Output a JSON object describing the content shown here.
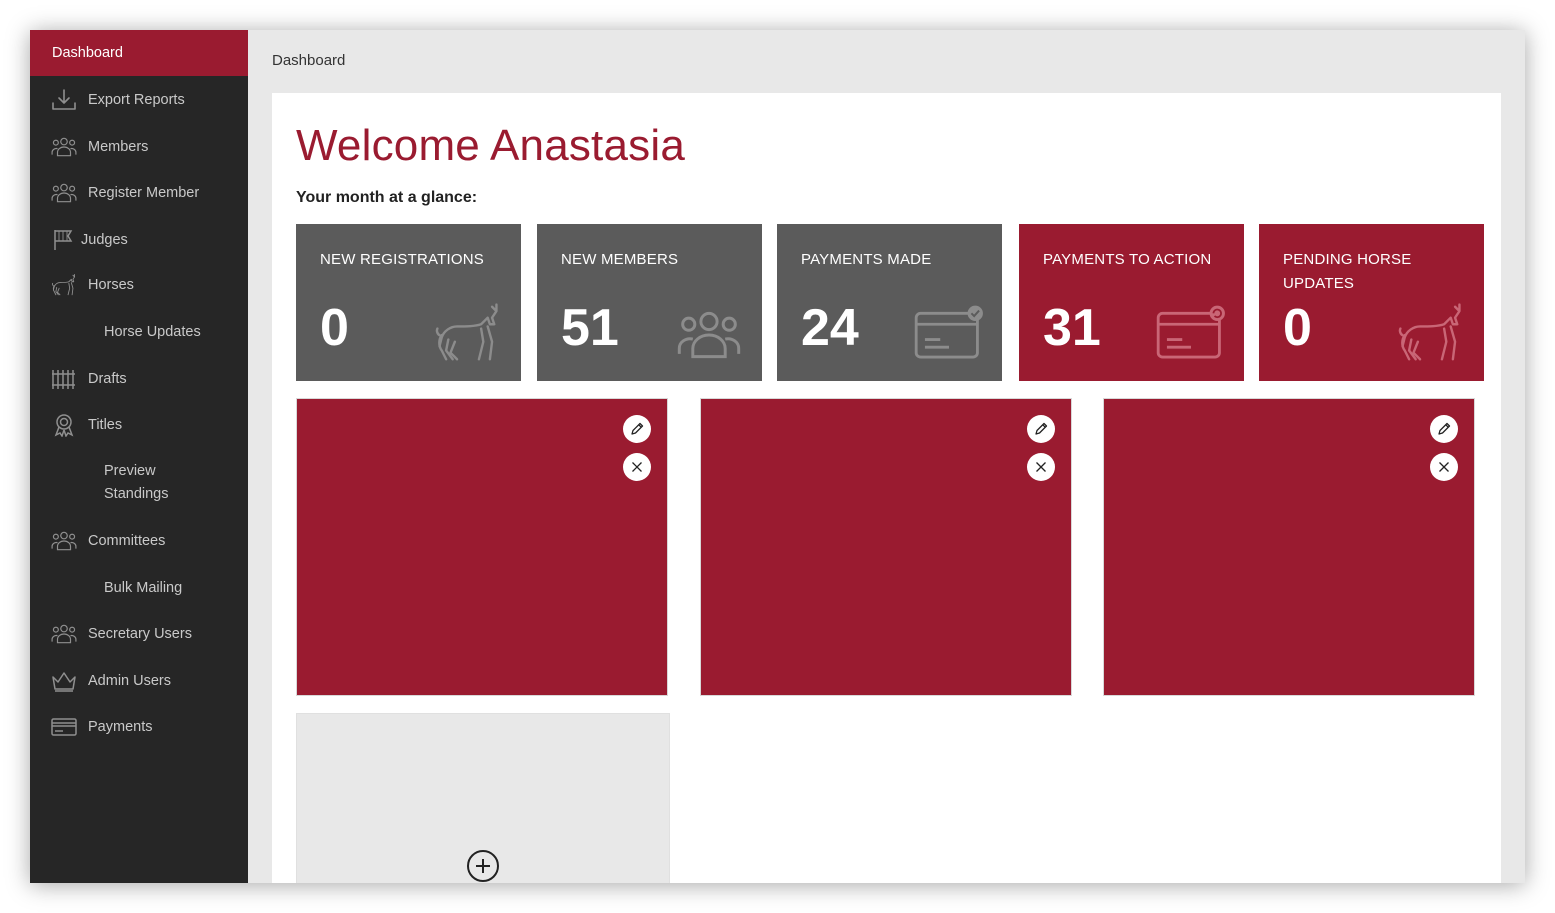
{
  "sidebar": {
    "items": [
      {
        "label": "Dashboard",
        "icon": "none",
        "active": true
      },
      {
        "label": "Export Reports",
        "icon": "download-icon"
      },
      {
        "label": "Members",
        "icon": "users-icon"
      },
      {
        "label": "Register Member",
        "icon": "users-icon"
      },
      {
        "label": "Judges",
        "icon": "flag-icon"
      },
      {
        "label": "Horses",
        "icon": "horse-icon"
      },
      {
        "label": "Horse Updates",
        "icon": "none",
        "sub": true
      },
      {
        "label": "Drafts",
        "icon": "fence-icon"
      },
      {
        "label": "Titles",
        "icon": "award-icon"
      },
      {
        "label": "Preview Standings",
        "icon": "none",
        "sub": true
      },
      {
        "label": "Committees",
        "icon": "users-icon"
      },
      {
        "label": "Bulk Mailing",
        "icon": "none",
        "sub": true
      },
      {
        "label": "Secretary Users",
        "icon": "users-icon"
      },
      {
        "label": "Admin Users",
        "icon": "crown-icon"
      },
      {
        "label": "Payments",
        "icon": "credit-card-icon"
      }
    ]
  },
  "header": {
    "breadcrumb": "Dashboard"
  },
  "main": {
    "welcome": "Welcome Anastasia",
    "glance": "Your month at a glance:",
    "stats": [
      {
        "title": "NEW REGISTRATIONS",
        "value": "0",
        "icon": "horse-icon",
        "color": "#5b5b5b"
      },
      {
        "title": "NEW MEMBERS",
        "value": "51",
        "icon": "users-icon",
        "color": "#5b5b5b"
      },
      {
        "title": "PAYMENTS MADE",
        "value": "24",
        "icon": "card-check-icon",
        "color": "#5b5b5b"
      },
      {
        "title": "PAYMENTS TO ACTION",
        "value": "31",
        "icon": "card-refresh-icon",
        "color": "#9a1b30"
      },
      {
        "title": "PENDING HORSE UPDATES",
        "value": "0",
        "icon": "horse-icon",
        "color": "#9a1b30"
      }
    ],
    "widget_count": 3,
    "widget_color": "#9a1b30",
    "add_widget_icon": "plus-circle-icon"
  },
  "colors": {
    "accent": "#9a1b30",
    "sidebar": "#262626",
    "stat_grey": "#5b5b5b"
  }
}
